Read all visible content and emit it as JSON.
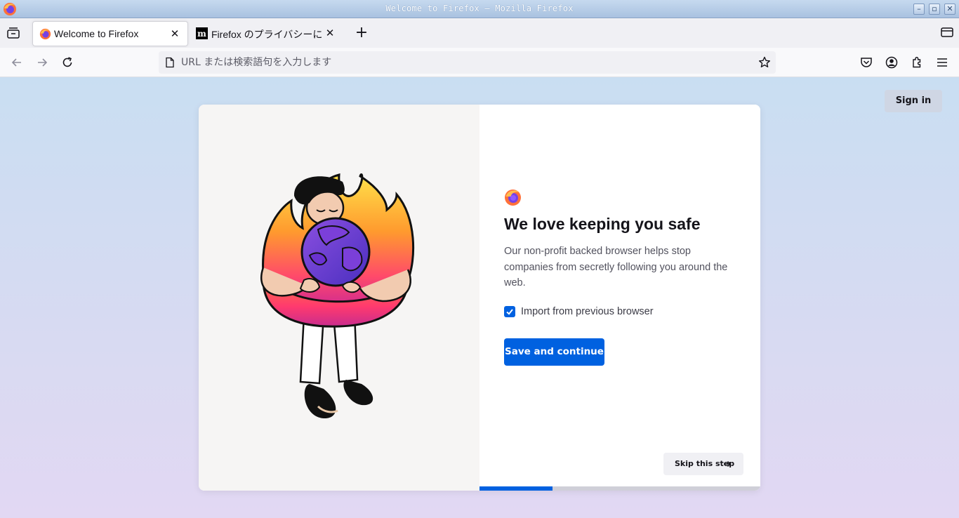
{
  "window": {
    "title": "Welcome to Firefox — Mozilla Firefox",
    "app_icon": "firefox-logo-icon",
    "controls": [
      "minimize",
      "maximize",
      "close"
    ]
  },
  "tabs": [
    {
      "label": "Welcome to Firefox",
      "favicon": "firefox-logo-icon",
      "active": true
    },
    {
      "label": "Firefox のプライバシーに",
      "favicon": "mozilla-m-icon",
      "active": false
    }
  ],
  "navbar": {
    "url_placeholder": "URL または検索語句を入力します",
    "url_value": ""
  },
  "page": {
    "sign_in_label": "Sign in",
    "heading": "We love keeping you safe",
    "description": "Our non-profit backed browser helps stop companies from secretly following you around the web.",
    "import_checkbox_label": "Import from previous browser",
    "import_checked": true,
    "primary_button_label": "Save and continue",
    "skip_label": "Skip this step",
    "progress_fraction": 0.26
  },
  "colors": {
    "accent": "#0061e0",
    "page_bg_top": "#c9def2",
    "page_bg_bottom": "#e2d8f3",
    "card_left_bg": "#f6f5f4"
  }
}
